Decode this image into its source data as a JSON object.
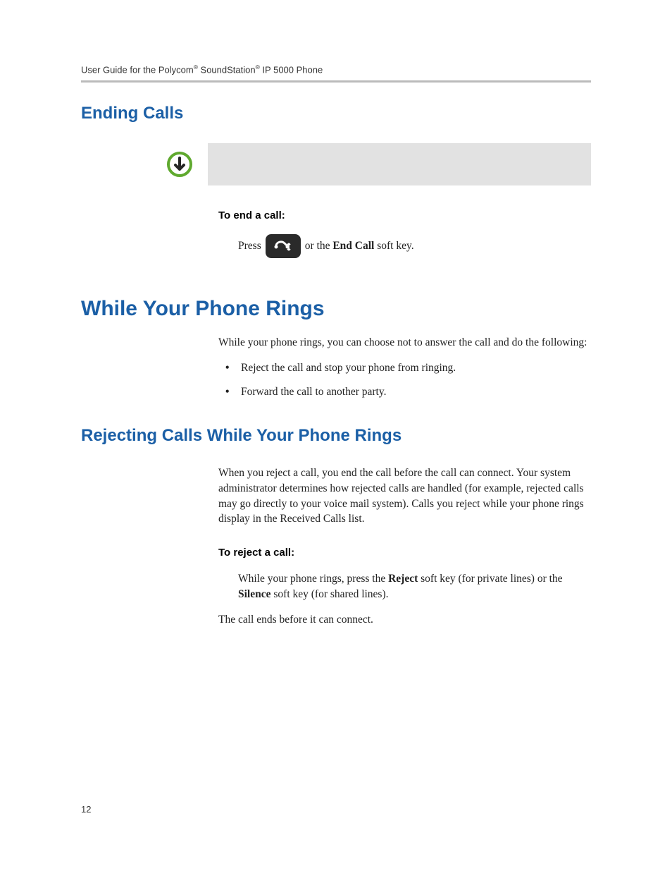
{
  "header": {
    "running_head": "User Guide for the Polycom® SoundStation® IP 5000 Phone"
  },
  "section_ending_calls": {
    "title": "Ending Calls",
    "step_head": "To end a call:",
    "press_prefix": "Press",
    "press_suffix_1": " or the ",
    "press_bold": "End Call",
    "press_suffix_2": " soft key."
  },
  "section_while_rings": {
    "title": "While Your Phone Rings",
    "intro": "While your phone rings, you can choose not to answer the call and do the following:",
    "bullets": [
      "Reject the call and stop your phone from ringing.",
      "Forward the call to another party."
    ]
  },
  "section_rejecting": {
    "title": "Rejecting Calls While Your Phone Rings",
    "para": "When you reject a call, you end the call before the call can connect. Your system administrator determines how rejected calls are handled (for example, rejected calls may go directly to your voice mail system). Calls you reject while your phone rings display in the Received Calls list.",
    "step_head": "To reject a call:",
    "step_prefix": "While your phone rings, press the ",
    "step_bold1": "Reject",
    "step_mid": " soft key (for private lines) or the ",
    "step_bold2": "Silence",
    "step_suffix": " soft key (for shared lines).",
    "closing": "The call ends before it can connect."
  },
  "page_number": "12"
}
